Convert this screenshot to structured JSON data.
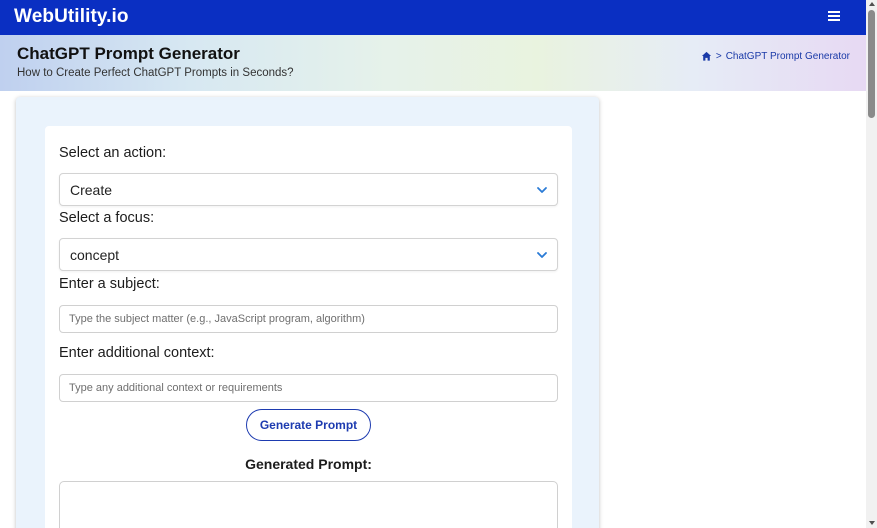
{
  "header": {
    "brand": "WebUtility.io",
    "menu_icon": "hamburger-menu-icon"
  },
  "hero": {
    "title": "ChatGPT Prompt Generator",
    "subtitle": "How to Create Perfect ChatGPT Prompts in Seconds?",
    "breadcrumb": {
      "home_icon": "home-icon",
      "separator": ">",
      "current": "ChatGPT Prompt Generator"
    }
  },
  "form": {
    "action_label": "Select an action:",
    "action_value": "Create",
    "focus_label": "Select a focus:",
    "focus_value": "concept",
    "subject_label": "Enter a subject:",
    "subject_placeholder": "Type the subject matter (e.g., JavaScript program, algorithm)",
    "context_label": "Enter additional context:",
    "context_placeholder": "Type any additional context or requirements",
    "generate_label": "Generate Prompt",
    "output_title": "Generated Prompt:",
    "output_value": ""
  },
  "colors": {
    "nav": "#0a2fc2",
    "accent": "#1d3bb0",
    "panel": "#eaf3fc",
    "chevron": "#2a7bd6"
  }
}
